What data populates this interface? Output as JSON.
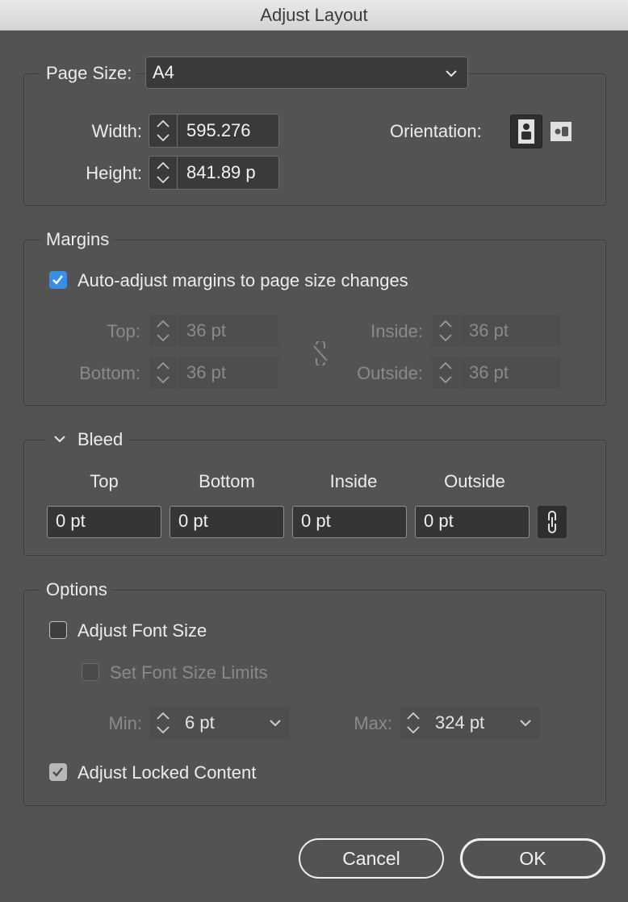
{
  "window": {
    "title": "Adjust Layout"
  },
  "page_size": {
    "label": "Page Size:",
    "value": "A4",
    "width_label": "Width:",
    "width_value": "595.276",
    "height_label": "Height:",
    "height_value": "841.89 p",
    "orientation_label": "Orientation:",
    "orientation_selected": "portrait"
  },
  "margins": {
    "legend": "Margins",
    "auto_adjust_label": "Auto-adjust margins to page size changes",
    "auto_adjust_checked": true,
    "top_label": "Top:",
    "top_value": "36 pt",
    "bottom_label": "Bottom:",
    "bottom_value": "36 pt",
    "inside_label": "Inside:",
    "inside_value": "36 pt",
    "outside_label": "Outside:",
    "outside_value": "36 pt"
  },
  "bleed": {
    "legend": "Bleed",
    "columns": [
      "Top",
      "Bottom",
      "Inside",
      "Outside"
    ],
    "values": [
      "0 pt",
      "0 pt",
      "0 pt",
      "0 pt"
    ]
  },
  "options": {
    "legend": "Options",
    "adjust_font_size_label": "Adjust Font Size",
    "adjust_font_size_checked": false,
    "set_limits_label": "Set Font Size Limits",
    "set_limits_checked": false,
    "min_label": "Min:",
    "min_value": "6 pt",
    "max_label": "Max:",
    "max_value": "324 pt",
    "adjust_locked_label": "Adjust Locked Content",
    "adjust_locked_checked": true
  },
  "buttons": {
    "cancel": "Cancel",
    "ok": "OK"
  },
  "colors": {
    "accent": "#3a8ee6",
    "background": "#535353"
  }
}
